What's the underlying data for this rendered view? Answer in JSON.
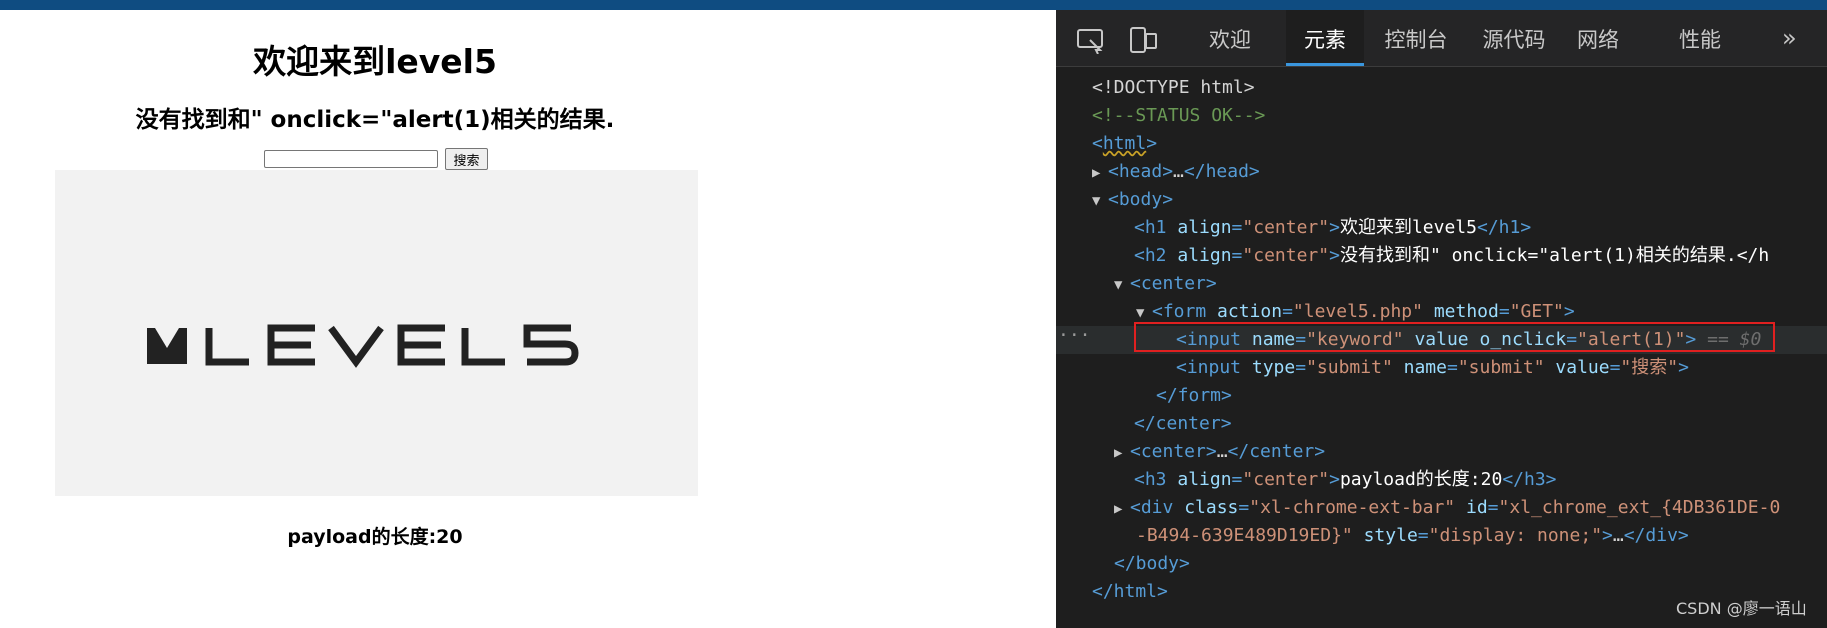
{
  "page": {
    "h1": "欢迎来到level5",
    "h2": "没有找到和\" onclick=\"alert(1)相关的结果.",
    "search_value": "",
    "search_button": "搜索",
    "logo_text": "LEVEL5",
    "h3": "payload的长度:20"
  },
  "devtools": {
    "tabs": [
      {
        "label": "欢迎"
      },
      {
        "label": "元素"
      },
      {
        "label": "控制台"
      },
      {
        "label": "源代码"
      },
      {
        "label": "网络"
      },
      {
        "label": "性能"
      }
    ],
    "active_tab": "元素",
    "more_icon": "»",
    "code": {
      "doctype": "<!DOCTYPE html>",
      "comment": "<!--STATUS OK-->",
      "html_open": "html",
      "head_collapsed": "head",
      "body_open": "body",
      "h1_align": "center",
      "h1_text": "欢迎来到level5",
      "h2_align": "center",
      "h2_text": "没有找到和\" onclick=\"alert(1)相关的结果.</h",
      "center_tag": "center",
      "form_action": "level5.php",
      "form_method": "GET",
      "input1_name": "keyword",
      "input1_value_attr": "value",
      "input1_onclick_attr": "o_nclick",
      "input1_onclick_val": "alert(1)",
      "eq_marker": "==",
      "dollar": "$0",
      "input2_type": "submit",
      "input2_name": "submit",
      "input2_value": "搜索",
      "h3_align": "center",
      "h3_text": "payload的长度:20",
      "div_class": "xl-chrome-ext-bar",
      "div_id": "xl_chrome_ext_{4DB361DE-0",
      "div_id_cont": "-B494-639E489D19ED}",
      "div_style": "display: none;"
    },
    "dots": "···"
  },
  "watermark": "CSDN @廖一语山",
  "colors": {
    "topbar": "#0f4c81",
    "devtools_bg": "#1e1e1e",
    "tag": "#569cd6",
    "attr": "#9cdcfe",
    "value": "#ce9178",
    "highlight": "#e02020"
  }
}
